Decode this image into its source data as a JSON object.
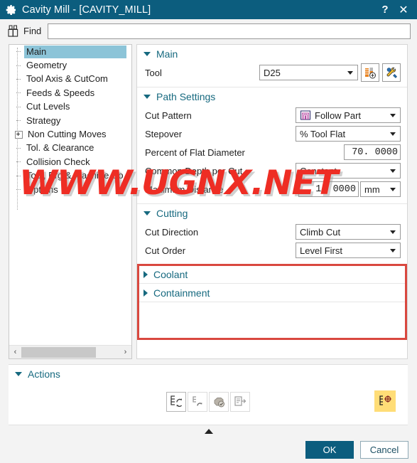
{
  "window": {
    "title": "Cavity Mill - [CAVITY_MILL]",
    "icon": "gear-icon",
    "help_label": "?",
    "close_label": "✕",
    "titlebar_color": "#0c5d7e"
  },
  "find": {
    "icon": "binoculars-icon",
    "label": "Find",
    "value": "",
    "placeholder": ""
  },
  "tree": {
    "items": [
      {
        "label": "Main",
        "selected": true,
        "expandable": false
      },
      {
        "label": "Geometry",
        "selected": false,
        "expandable": false
      },
      {
        "label": "Tool Axis & CutCom",
        "selected": false,
        "expandable": false
      },
      {
        "label": "Feeds & Speeds",
        "selected": false,
        "expandable": false
      },
      {
        "label": "Cut Levels",
        "selected": false,
        "expandable": false
      },
      {
        "label": "Strategy",
        "selected": false,
        "expandable": false
      },
      {
        "label": "Non Cutting Moves",
        "selected": false,
        "expandable": true
      },
      {
        "label": "Tol. & Clearance",
        "selected": false,
        "expandable": false
      },
      {
        "label": "Collision Check",
        "selected": false,
        "expandable": false
      },
      {
        "label": "Tool, Prg & Machine Co",
        "selected": false,
        "expandable": false
      },
      {
        "label": "Options",
        "selected": false,
        "expandable": false
      }
    ],
    "scroll_left_arrow": "‹",
    "scroll_right_arrow": "›",
    "selection_color": "#8cc4d8"
  },
  "panel": {
    "heading_color": "#16697f",
    "groups": [
      {
        "name": "main",
        "title": "Main",
        "expanded": true,
        "rows": [
          {
            "name": "tool",
            "label": "Tool",
            "control": "combo",
            "value": "D25",
            "buttons": [
              {
                "name": "new-tool-button",
                "icon": "tool-plus-icon"
              },
              {
                "name": "edit-tool-button",
                "icon": "tool-wrench-icon"
              }
            ]
          }
        ]
      },
      {
        "name": "path-settings",
        "title": "Path Settings",
        "expanded": true,
        "rows": [
          {
            "name": "cut-pattern",
            "label": "Cut Pattern",
            "control": "combo",
            "value": "Follow Part",
            "icon": "follow-part-icon"
          },
          {
            "name": "stepover",
            "label": "Stepover",
            "control": "combo",
            "value": "% Tool Flat"
          },
          {
            "name": "percent-of-flat-diameter",
            "label": "Percent of Flat Diameter",
            "control": "number",
            "value": "70. 0000"
          },
          {
            "name": "common-depth-per-cut",
            "label": "Common Depth per Cut",
            "control": "combo",
            "value": "Constant"
          },
          {
            "name": "maximum-distance",
            "label": "Maximum Distance",
            "control": "number-unit",
            "value": "1. 0000",
            "unit": "mm"
          }
        ]
      },
      {
        "name": "cutting",
        "title": "Cutting",
        "expanded": true,
        "highlighted": true,
        "highlight_color": "#d9483f",
        "rows": [
          {
            "name": "cut-direction",
            "label": "Cut Direction",
            "control": "combo",
            "value": "Climb Cut"
          },
          {
            "name": "cut-order",
            "label": "Cut Order",
            "control": "combo",
            "value": "Level First"
          }
        ]
      },
      {
        "name": "coolant",
        "title": "Coolant",
        "expanded": false,
        "rows": []
      },
      {
        "name": "containment",
        "title": "Containment",
        "expanded": false,
        "rows": []
      }
    ]
  },
  "actions": {
    "title": "Actions",
    "expanded": true,
    "buttons": [
      {
        "name": "generate-button",
        "icon": "generate-toolpath-icon"
      },
      {
        "name": "replay-button",
        "icon": "replay-toolpath-icon"
      },
      {
        "name": "verify-button",
        "icon": "verify-solid-icon"
      },
      {
        "name": "list-button",
        "icon": "list-output-icon"
      }
    ],
    "pinned_button": {
      "name": "show-toolpath-button",
      "icon": "toolpath-target-icon",
      "color": "#ffdd77"
    }
  },
  "footer": {
    "ok_label": "OK",
    "cancel_label": "Cancel",
    "ok_color": "#0c5d7e",
    "collapse_icon": "chevron-up-icon"
  },
  "watermark": {
    "line1": "WWW.UGNX.NET",
    "color": "#ee2d24"
  }
}
